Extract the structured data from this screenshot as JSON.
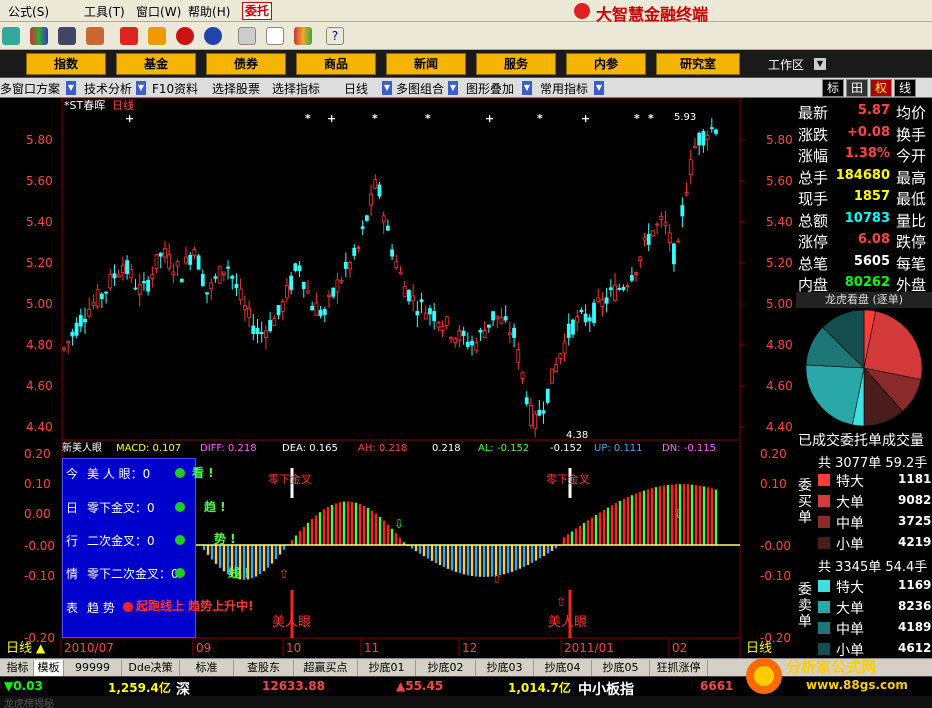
{
  "menu": {
    "items": [
      "公式",
      "工具",
      "窗口",
      "帮助"
    ],
    "shortcuts": [
      "(S)",
      "(T)",
      "(W)",
      "(H)"
    ],
    "entrust": "委托",
    "brand": "大智慧金融终端"
  },
  "nav": {
    "buttons": [
      "指数",
      "基金",
      "债券",
      "商品",
      "新闻",
      "服务",
      "内参",
      "研究室"
    ],
    "workzone": "工作区"
  },
  "funcbar": {
    "items": [
      "多窗口方案",
      "技术分析",
      "F10资料",
      "选择股票",
      "选择指标",
      "日线",
      "多图组合",
      "图形叠加",
      "常用指标"
    ],
    "right_tabs": [
      "标",
      "田",
      "权",
      "线"
    ]
  },
  "chart": {
    "stock_name": "*ST春晖",
    "period": "日线",
    "y_ticks": [
      "5.80",
      "5.60",
      "5.40",
      "5.20",
      "5.00",
      "4.80",
      "4.60",
      "4.40"
    ],
    "high_label": "5.93",
    "low_label": "4.38",
    "macd_ticks": [
      "0.20",
      "0.10",
      "0.00",
      "-0.00",
      "-0.10",
      "-0.20"
    ],
    "macd_ticks_right": [
      "0.20",
      "0.10",
      "-0.00",
      "-0.10",
      "-0.20"
    ],
    "x_labels": [
      "2010/07",
      "09",
      "10",
      "11",
      "12",
      "2011/01",
      "02"
    ],
    "indicator_name": "新美人眼",
    "indicator_text": {
      "macd": "MACD: 0.107",
      "diff": "DIFF: 0.218",
      "dea": "DEA: 0.165",
      "ah": "AH: 0.218",
      "v1": "0.218",
      "al": "AL: -0.152",
      "v2": "-0.152",
      "up": "UP: 0.111",
      "dn": "DN: -0.115"
    },
    "annotations": {
      "zero_cross_1": "零下金叉",
      "zero_cross_2": "零下金叉",
      "beauty_eye_1": "美人眼",
      "beauty_eye_2": "美人眼"
    },
    "bottom_left": "日线",
    "bottom_right": "日线"
  },
  "info_box": {
    "side": [
      "今",
      "日",
      "行",
      "情",
      "表"
    ],
    "rows": [
      "美 人 眼：0",
      "零下金叉：0",
      "二次金叉：0",
      "零下二次金叉：0"
    ],
    "marks": [
      "看 !",
      "趋 !",
      "势 !",
      "线 !"
    ],
    "trend_label": "趋 势",
    "trend_value": "起跑线上 趋势上升中!"
  },
  "quote": {
    "rows": [
      {
        "label": "最新",
        "value": "5.87",
        "label2": "均价",
        "color": "#ff4444"
      },
      {
        "label": "涨跌",
        "value": "+0.08",
        "label2": "换手",
        "color": "#ff4444"
      },
      {
        "label": "涨幅",
        "value": "1.38%",
        "label2": "今开",
        "color": "#ff4444"
      },
      {
        "label": "总手",
        "value": "184680",
        "label2": "最高",
        "color": "#ffff00"
      },
      {
        "label": "现手",
        "value": "1857",
        "label2": "最低",
        "color": "#ffff00"
      },
      {
        "label": "总额",
        "value": "10783",
        "label2": "量比",
        "color": "#00ffff"
      },
      {
        "label": "涨停",
        "value": "6.08",
        "label2": "跌停",
        "color": "#ff4444"
      },
      {
        "label": "总笔",
        "value": "5605",
        "label2": "每笔",
        "color": "#ffffff"
      },
      {
        "label": "内盘",
        "value": "80262",
        "label2": "外盘",
        "color": "#00ff00"
      }
    ],
    "dragon_title": "龙虎看盘 (逐单)",
    "done_label": "已成交委托单成交量"
  },
  "orders": {
    "buy_head": "共 3077单 59.2手",
    "buy_label": "委买单",
    "buy_rows": [
      {
        "name": "特大",
        "value": "1181",
        "color": "#ff3b3b"
      },
      {
        "name": "大单",
        "value": "9082",
        "color": "#d43a3a"
      },
      {
        "name": "中单",
        "value": "3725",
        "color": "#8a2a2a"
      },
      {
        "name": "小单",
        "value": "4219",
        "color": "#4a1d1d"
      }
    ],
    "sell_head": "共 3345单 54.4手",
    "sell_label": "委卖单",
    "sell_rows": [
      {
        "name": "特大",
        "value": "1169",
        "color": "#3fe0e0"
      },
      {
        "name": "大单",
        "value": "8236",
        "color": "#2aa8a8"
      },
      {
        "name": "中单",
        "value": "4189",
        "color": "#1d7777"
      },
      {
        "name": "小单",
        "value": "4612",
        "color": "#134d4d"
      }
    ]
  },
  "tabs": [
    "指标",
    "模板",
    "99999",
    "Dde决策",
    "标准",
    "查股东",
    "超赢买点",
    "抄底01",
    "抄底02",
    "抄底03",
    "抄底04",
    "抄底05",
    "狂抓涨停"
  ],
  "status": {
    "s1": "▼0.03",
    "s2": "1,259.4亿",
    "s3": "深",
    "s4": "12633.88",
    "s5": "▲55.45",
    "s6": "1,014.7亿",
    "s7": "中小板指",
    "s8": "6661"
  },
  "footer": "龙虎榜揭秘",
  "watermark": {
    "text": "分析家公式网",
    "url": "www.88gs.com"
  },
  "pie_data": [
    {
      "value": 1181,
      "color": "#ff3b3b"
    },
    {
      "value": 9082,
      "color": "#d43a3a"
    },
    {
      "value": 3725,
      "color": "#8a2a2a"
    },
    {
      "value": 4219,
      "color": "#4a1d1d"
    },
    {
      "value": 1169,
      "color": "#3fe0e0"
    },
    {
      "value": 8236,
      "color": "#2aa8a8"
    },
    {
      "value": 4189,
      "color": "#1d7777"
    },
    {
      "value": 4612,
      "color": "#134d4d"
    }
  ]
}
